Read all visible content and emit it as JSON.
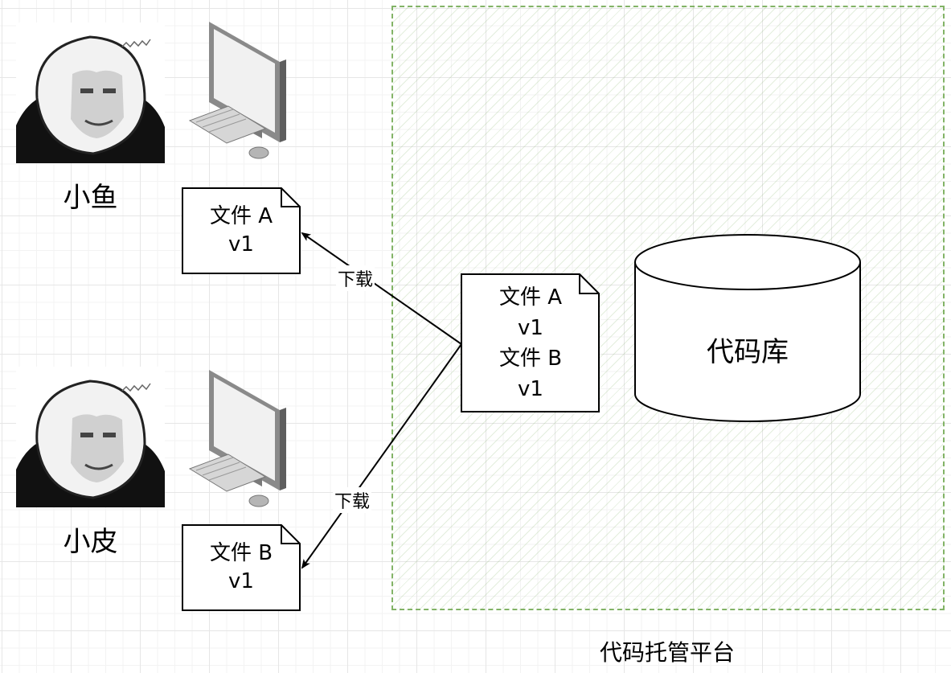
{
  "people": [
    {
      "name": "小鱼"
    },
    {
      "name": "小皮"
    }
  ],
  "local_files": [
    {
      "line1": "文件 A",
      "line2": "v1"
    },
    {
      "line1": "文件 B",
      "line2": "v1"
    }
  ],
  "server_file": {
    "line1": "文件 A",
    "line2": "v1",
    "line3": "文件 B",
    "line4": "v1"
  },
  "repository": {
    "label": "代码库"
  },
  "platform": {
    "label": "代码托管平台"
  },
  "edges": [
    {
      "label": "下载"
    },
    {
      "label": "下载"
    }
  ],
  "colors": {
    "platform_border": "#82b366",
    "grid": "#e6e6e6"
  }
}
